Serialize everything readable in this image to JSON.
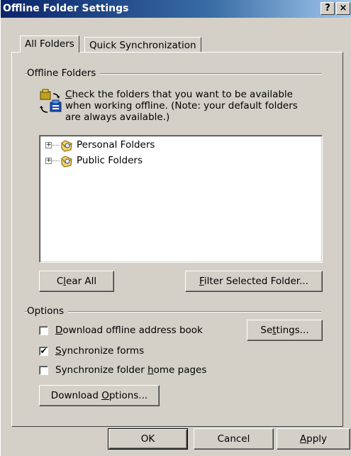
{
  "window": {
    "title": "Offline Folder Settings",
    "help_button": "?",
    "close_button": "×"
  },
  "tabs": [
    {
      "label": "All Folders",
      "active": true
    },
    {
      "label": "Quick Synchronization",
      "active": false
    }
  ],
  "offline_folders": {
    "group_label": "Offline Folders",
    "description": {
      "mnemonic": "C",
      "rest_line1": "heck the folders that you want to be available",
      "line2": "when working offline.  (Note: your default folders",
      "line3": "are always available.)"
    },
    "tree_items": [
      {
        "label": "Personal Folders",
        "expander": "+"
      },
      {
        "label": "Public Folders",
        "expander": "+"
      }
    ],
    "clear_all": {
      "pre": "C",
      "mnemonic": "l",
      "post": "ear All"
    },
    "filter_selected": {
      "pre": "",
      "mnemonic": "F",
      "post": "ilter Selected Folder..."
    }
  },
  "options": {
    "group_label": "Options",
    "download_address_book": {
      "pre": "",
      "mnemonic": "D",
      "post": "ownload offline address book",
      "checked": false
    },
    "settings_button": {
      "pre": "Se",
      "mnemonic": "t",
      "post": "tings..."
    },
    "synchronize_forms": {
      "pre": "",
      "mnemonic": "S",
      "post": "ynchronize forms",
      "checked": true
    },
    "sync_home_pages": {
      "pre": "Synchronize folder ",
      "mnemonic": "h",
      "post": "ome pages",
      "checked": false
    },
    "download_options": {
      "pre": "Download ",
      "mnemonic": "O",
      "post": "ptions..."
    }
  },
  "footer": {
    "ok": "OK",
    "cancel": "Cancel",
    "apply": {
      "pre": "",
      "mnemonic": "A",
      "post": "pply"
    }
  },
  "colors": {
    "titlebar_start": "#0a246a",
    "titlebar_end": "#a6caf0",
    "face": "#d4d0c8"
  }
}
